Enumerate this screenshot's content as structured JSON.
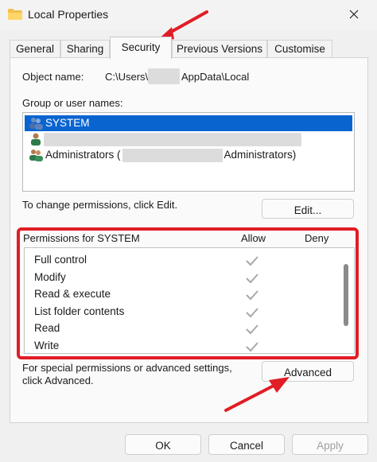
{
  "window": {
    "title": "Local Properties",
    "close_glyph": "✕"
  },
  "tabs": [
    {
      "label": "General"
    },
    {
      "label": "Sharing"
    },
    {
      "label": "Security"
    },
    {
      "label": "Previous Versions"
    },
    {
      "label": "Customise"
    }
  ],
  "object": {
    "label": "Object name:",
    "path_prefix": "C:\\Users\\",
    "path_suffix": "AppData\\Local"
  },
  "group": {
    "label": "Group or user names:",
    "items": [
      {
        "name": "SYSTEM",
        "selected": true
      },
      {
        "name": "",
        "selected": false
      },
      {
        "name_prefix": "Administrators (",
        "name_suffix": "Administrators)",
        "selected": false
      }
    ]
  },
  "edit": {
    "hint": "To change permissions, click Edit.",
    "button": "Edit..."
  },
  "permissions": {
    "header": "Permissions for SYSTEM",
    "allow_label": "Allow",
    "deny_label": "Deny",
    "rows": [
      {
        "name": "Full control",
        "allow": true
      },
      {
        "name": "Modify",
        "allow": true
      },
      {
        "name": "Read & execute",
        "allow": true
      },
      {
        "name": "List folder contents",
        "allow": true
      },
      {
        "name": "Read",
        "allow": true
      },
      {
        "name": "Write",
        "allow": true
      }
    ]
  },
  "advanced": {
    "hint_line1": "For special permissions or advanced settings,",
    "hint_line2": "click Advanced.",
    "button": "Advanced"
  },
  "footer": {
    "ok": "OK",
    "cancel": "Cancel",
    "apply": "Apply"
  },
  "colors": {
    "selection": "#0a64d0",
    "highlight": "#e11d25",
    "arrow": "#e11d25"
  },
  "icons": [
    "folder-icon",
    "close-icon",
    "user-group-icon",
    "user-icon",
    "check-icon",
    "arrow-pointer"
  ]
}
